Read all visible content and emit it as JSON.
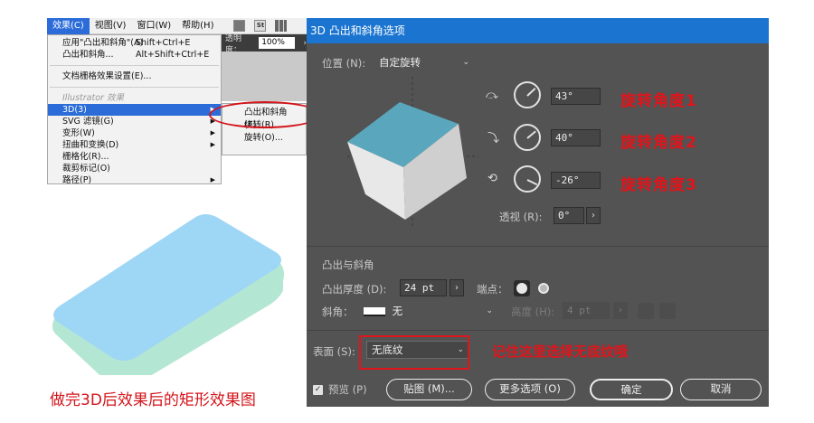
{
  "menubar": {
    "items": [
      "效果(C)",
      "视图(V)",
      "窗口(W)",
      "帮助(H)"
    ],
    "icon_st": "St"
  },
  "app_toolbar": {
    "opacity_label": "透明度：",
    "opacity_value": "100%",
    "arrow": "›"
  },
  "effect_menu": {
    "items": [
      {
        "label": "应用\"凸出和斜角\"(A)",
        "shortcut": "Shift+Ctrl+E"
      },
      {
        "label": "凸出和斜角...",
        "shortcut": "Alt+Shift+Ctrl+E"
      },
      {
        "label": "文档栅格效果设置(E)..."
      },
      {
        "label": "Illustrator 效果"
      },
      {
        "label": "3D(3)"
      },
      {
        "label": "SVG 滤镜(G)"
      },
      {
        "label": "变形(W)"
      },
      {
        "label": "扭曲和变换(D)"
      },
      {
        "label": "栅格化(R)..."
      },
      {
        "label": "裁剪标记(O)"
      },
      {
        "label": "路径(P)"
      }
    ]
  },
  "submenu_3d": {
    "items": [
      "凸出和斜角(E)...",
      "绕转(R)...",
      "旋转(O)..."
    ]
  },
  "left_caption": "做完3D后效果后的矩形效果图",
  "dialog": {
    "title": "3D 凸出和斜角选项",
    "position_label": "位置 (N):",
    "position_value": "自定旋转",
    "rotations": [
      {
        "axis_icon": "x-axis-rotate-icon",
        "value": "43°",
        "note": "旋转角度1"
      },
      {
        "axis_icon": "y-axis-rotate-icon",
        "value": "40°",
        "note": "旋转角度2"
      },
      {
        "axis_icon": "z-axis-rotate-icon",
        "value": "-26°",
        "note": "旋转角度3"
      }
    ],
    "perspective_label": "透视 (R):",
    "perspective_value": "0°",
    "extrude_section": "凸出与斜角",
    "extrude_depth_label": "凸出厚度 (D):",
    "extrude_depth_value": "24 pt",
    "cap_label": "端点：",
    "bevel_label": "斜角：",
    "bevel_value": "无",
    "height_label": "高度 (H):",
    "height_value": "4 pt",
    "surface_label": "表面 (S):",
    "surface_value": "无底纹",
    "surface_note": "记住这里选择无底纹哦",
    "preview_label": "预览 (P)",
    "map_art_button": "贴图 (M)...",
    "more_options_button": "更多选项 (O)",
    "ok_button": "确定",
    "cancel_button": "取消"
  },
  "colors": {
    "title_blue": "#1b75d0",
    "dialog_bg": "#535353",
    "cube_top": "#5aa7bd",
    "round_rect_top": "#9ed6f5",
    "round_rect_side": "#b4e6d4",
    "annotation_red": "#e0141b"
  }
}
